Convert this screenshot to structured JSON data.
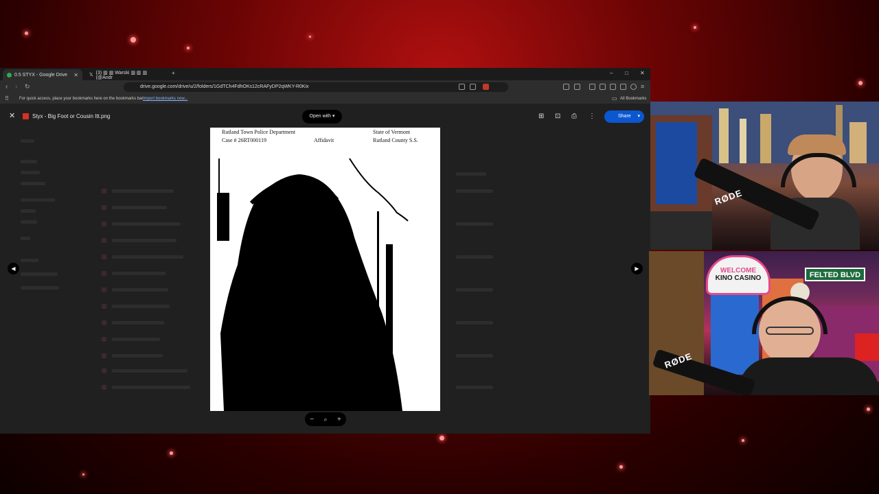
{
  "browser": {
    "tabs": [
      {
        "label": "0.5 STYX - Google Drive",
        "active": true
      },
      {
        "label": "(3) ▥ ▥ Warski ▥ ▥ ▥ (@Andr",
        "active": false
      }
    ],
    "new_tab": "+",
    "window": {
      "minimize": "–",
      "maximize": "□",
      "close": "✕"
    },
    "url": "drive.google.com/drive/u/2/folders/1GdTCh4FdhOKs12cRAFyDP2qWKY-R0Kix",
    "bookmarks_hint": "For quick access, place your bookmarks here on the bookmarks bar.",
    "import_link": "Import bookmarks now...",
    "all_bookmarks": "All Bookmarks"
  },
  "preview": {
    "file_name": "Styx - Big Foot or Cousin Itt.png",
    "open_with": "Open with",
    "share": "Share",
    "zoom_out": "−",
    "zoom_in": "+"
  },
  "document": {
    "dept": "Rutland Town Police Department",
    "case": "Case # 26RT000119",
    "type": "Affidavit",
    "state": "State of Vermont",
    "county": "Rutland County S.S."
  },
  "cams": {
    "cam1_mic": "RØDE",
    "cam2_mic": "RØDE",
    "sign_top": "WELCOME",
    "sign_name": "KINO CASINO",
    "street_sign": "FELTED BLVD"
  },
  "colors": {
    "share": "#0b57d0",
    "bg_red": "#7a0606"
  }
}
